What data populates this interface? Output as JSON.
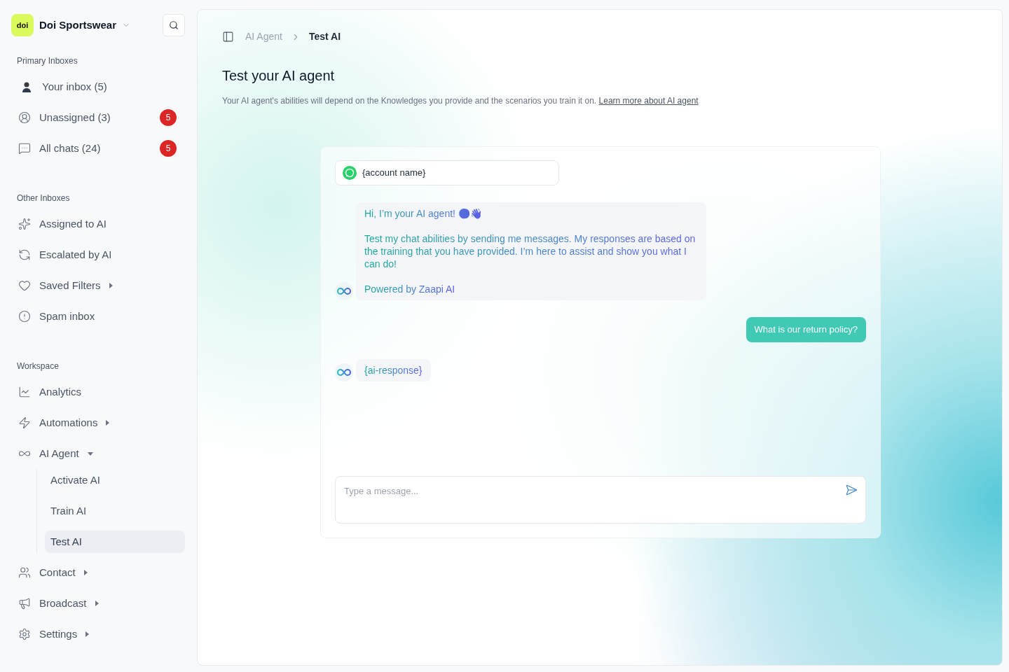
{
  "workspace": {
    "logo": "doi",
    "name": "Doi Sportswear"
  },
  "sidebar": {
    "sections": [
      {
        "title": "Primary Inboxes",
        "items": [
          {
            "kind": "avatar",
            "label": "Your inbox (5)",
            "selected": false
          },
          {
            "kind": "plain",
            "label": "Unassigned (3)",
            "badge": "5",
            "selected": false
          },
          {
            "kind": "plain",
            "label": "All chats (24)",
            "badge": "5",
            "selected": false
          }
        ]
      },
      {
        "title": "Other Inboxes",
        "items": [
          {
            "kind": "plain",
            "label": "Assigned to AI",
            "selected": false
          },
          {
            "kind": "plain",
            "label": "Escalated by AI",
            "selected": false
          },
          {
            "kind": "menu",
            "label": "Saved Filters",
            "expanded": false,
            "selected": false
          },
          {
            "kind": "plain",
            "label": "Spam inbox",
            "selected": false
          }
        ]
      },
      {
        "title": "Workspace",
        "items": [
          {
            "kind": "plain",
            "label": "Analytics",
            "selected": false
          },
          {
            "kind": "menu",
            "label": "Automations",
            "expanded": false,
            "selected": false
          },
          {
            "kind": "menu",
            "label": "AI Agent",
            "expanded": true,
            "selected": false,
            "children": [
              {
                "label": "Activate AI",
                "selected": false
              },
              {
                "label": "Train AI",
                "selected": false
              },
              {
                "label": "Test AI",
                "selected": true
              }
            ]
          },
          {
            "kind": "menu",
            "label": "Contact",
            "expanded": false,
            "selected": false
          },
          {
            "kind": "menu",
            "label": "Broadcast",
            "expanded": false,
            "selected": false
          },
          {
            "kind": "menu",
            "label": "Settings",
            "expanded": false,
            "selected": false
          }
        ]
      }
    ]
  },
  "breadcrumb": [
    "AI Agent",
    "Test AI"
  ],
  "page": {
    "title": "Test your AI agent",
    "description": "Your AI agent's abilities will depend on the Knowledges you provide and the scenarios you train it on.",
    "link": "Learn more about AI agent"
  },
  "chat": {
    "account": "{account name}",
    "messages": [
      {
        "kind": "ai",
        "lines": [
          "Hi, I’m your AI agent! 😊👋",
          "Test my chat abilities by sending me messages. My responses are based on the training that you have provided. I’m here to assist and show you what I can do!",
          "Powered by Zaapi AI"
        ]
      },
      {
        "kind": "user",
        "lines": [
          "What is our return policy?"
        ]
      },
      {
        "kind": "ai",
        "lines": [
          "{ai-response}"
        ]
      }
    ],
    "input": {
      "placeholder": "Type a message..."
    }
  }
}
